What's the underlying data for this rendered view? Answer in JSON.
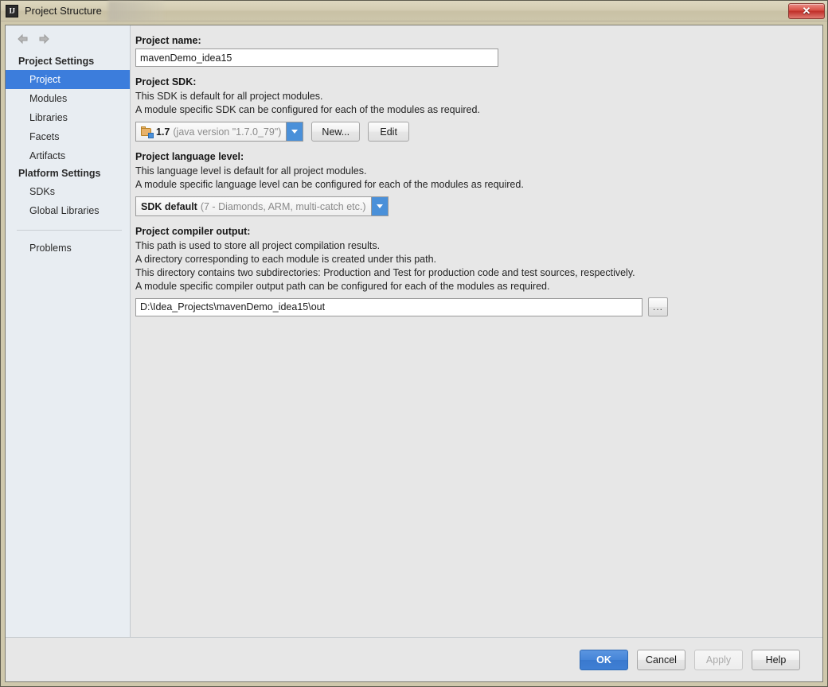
{
  "window": {
    "title": "Project Structure",
    "app_icon": "IJ",
    "close_label": "✕"
  },
  "sidebar": {
    "nav": {
      "back": "back-arrow",
      "forward": "forward-arrow"
    },
    "groups": [
      {
        "title": "Project Settings",
        "items": [
          {
            "label": "Project",
            "selected": true
          },
          {
            "label": "Modules",
            "selected": false
          },
          {
            "label": "Libraries",
            "selected": false
          },
          {
            "label": "Facets",
            "selected": false
          },
          {
            "label": "Artifacts",
            "selected": false
          }
        ]
      },
      {
        "title": "Platform Settings",
        "items": [
          {
            "label": "SDKs",
            "selected": false
          },
          {
            "label": "Global Libraries",
            "selected": false
          }
        ]
      }
    ],
    "footer_items": [
      {
        "label": "Problems",
        "selected": false
      }
    ]
  },
  "main": {
    "project_name": {
      "label": "Project name:",
      "value": "mavenDemo_idea15"
    },
    "project_sdk": {
      "label": "Project SDK:",
      "desc1": "This SDK is default for all project modules.",
      "desc2": "A module specific SDK can be configured for each of the modules as required.",
      "selected_main": "1.7",
      "selected_detail": "(java version \"1.7.0_79\")",
      "new_button": "New...",
      "edit_button": "Edit"
    },
    "language_level": {
      "label": "Project language level:",
      "desc1": "This language level is default for all project modules.",
      "desc2": "A module specific language level can be configured for each of the modules as required.",
      "selected_main": "SDK default",
      "selected_detail": "(7 - Diamonds, ARM, multi-catch etc.)"
    },
    "compiler_output": {
      "label": "Project compiler output:",
      "desc1": "This path is used to store all project compilation results.",
      "desc2": "A directory corresponding to each module is created under this path.",
      "desc3": "This directory contains two subdirectories: Production and Test for production code and test sources, respectively.",
      "desc4": "A module specific compiler output path can be configured for each of the modules as required.",
      "value": "D:\\Idea_Projects\\mavenDemo_idea15\\out",
      "browse_label": "..."
    }
  },
  "footer": {
    "ok": "OK",
    "cancel": "Cancel",
    "apply": "Apply",
    "help": "Help"
  },
  "colors": {
    "accent_blue": "#3c7ddc",
    "sidebar_bg": "#e8edf2",
    "content_bg": "#e7e7e7",
    "titlebar_bg": "#d3ccb2",
    "close_red": "#c0302a"
  }
}
